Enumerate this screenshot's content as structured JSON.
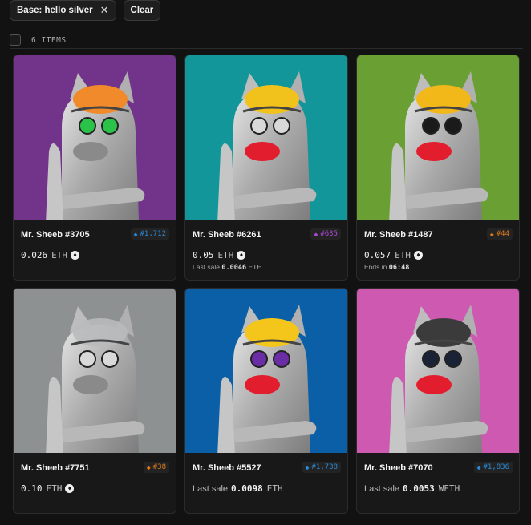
{
  "filters": {
    "chip_label": "Base: hello silver",
    "chip_close_icon": "close-icon",
    "clear_label": "Clear"
  },
  "list": {
    "count_label": "6 ITEMS"
  },
  "colors": {
    "page_bg": "#121212",
    "card_bg": "#181818",
    "eth_icon": "eth-logo-icon"
  },
  "items": [
    {
      "name": "Mr. Sheeb #3705",
      "rank": "#1,712",
      "rank_color": "#2b8ad9",
      "price": "0.026",
      "currency": "ETH",
      "art_bg": "#72348a"
    },
    {
      "name": "Mr. Sheeb #6261",
      "rank": "#635",
      "rank_color": "#b048d8",
      "price": "0.05",
      "currency": "ETH",
      "last_sale_label": "Last sale",
      "last_sale_value": "0.0046",
      "last_sale_currency": "ETH",
      "art_bg": "#13969a"
    },
    {
      "name": "Mr. Sheeb #1487",
      "rank": "#44",
      "rank_color": "#e07a1a",
      "price": "0.057",
      "currency": "ETH",
      "ends_label": "Ends in",
      "ends_value": "06:48",
      "art_bg": "#6aa033"
    },
    {
      "name": "Mr. Sheeb #7751",
      "rank": "#38",
      "rank_color": "#e07a1a",
      "price": "0.10",
      "currency": "ETH",
      "art_bg": "#8d9192"
    },
    {
      "name": "Mr. Sheeb #5527",
      "rank": "#1,738",
      "rank_color": "#2b8ad9",
      "last_sale_label": "Last sale",
      "last_sale_value": "0.0098",
      "last_sale_currency": "ETH",
      "art_bg": "#0a5fa6"
    },
    {
      "name": "Mr. Sheeb #7070",
      "rank": "#1,836",
      "rank_color": "#2b8ad9",
      "last_sale_label": "Last sale",
      "last_sale_value": "0.0053",
      "last_sale_currency": "WETH",
      "art_bg": "#cd5ab0"
    }
  ]
}
